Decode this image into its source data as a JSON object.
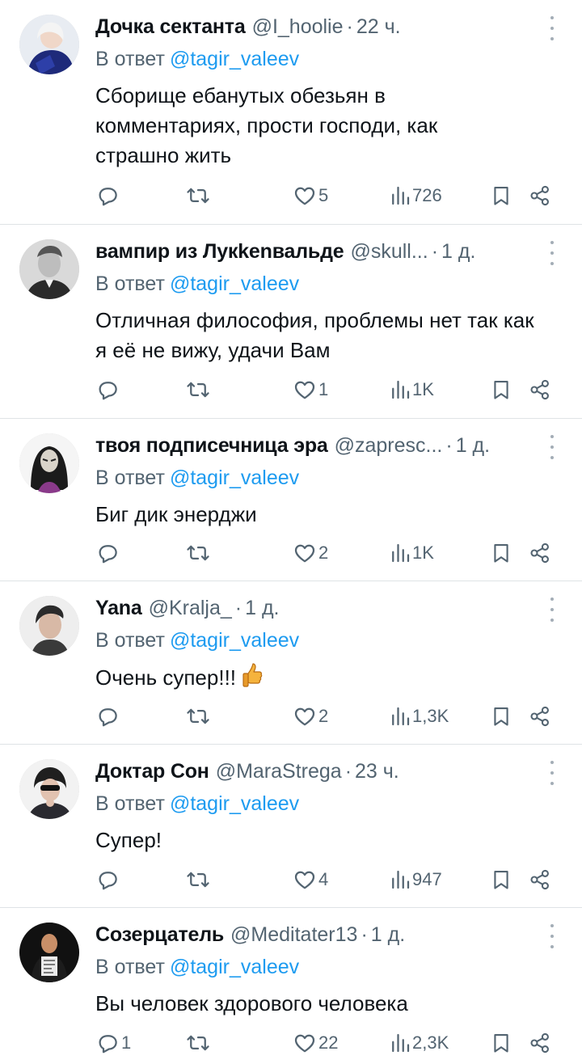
{
  "tweets": [
    {
      "name": "Дочка сектанта",
      "handle": "@I_hoolie",
      "time": "22 ч.",
      "reply_prefix": "В ответ",
      "reply_to": "@tagir_valeev",
      "text": "Сборище ебанутых обезьян в\nкомментариях, прости господи, как\nстрашно жить",
      "replies": "",
      "retweets": "",
      "likes": "5",
      "views": "726"
    },
    {
      "name": "вампир из Лукkenвальде",
      "handle": "@skull...",
      "time": "1 д.",
      "reply_prefix": "В ответ",
      "reply_to": "@tagir_valeev",
      "text": "Отличная философия, проблемы нет так как\nя её не вижу, удачи Вам",
      "replies": "",
      "retweets": "",
      "likes": "1",
      "views": "1K"
    },
    {
      "name": "твоя подписечница эра",
      "handle": "@zapresc...",
      "time": "1 д.",
      "reply_prefix": "В ответ",
      "reply_to": "@tagir_valeev",
      "text": "Биг дик энерджи",
      "replies": "",
      "retweets": "",
      "likes": "2",
      "views": "1K"
    },
    {
      "name": "Yana",
      "handle": "@Kralja_",
      "time": "1 д.",
      "reply_prefix": "В ответ",
      "reply_to": "@tagir_valeev",
      "text": "Очень супер!!!",
      "emoji": "thumbs-up",
      "replies": "",
      "retweets": "",
      "likes": "2",
      "views": "1,3K"
    },
    {
      "name": "Доктар Сон",
      "handle": "@MaraStrega",
      "time": "23 ч.",
      "reply_prefix": "В ответ",
      "reply_to": "@tagir_valeev",
      "text": "Супер!",
      "replies": "",
      "retweets": "",
      "likes": "4",
      "views": "947"
    },
    {
      "name": "Созерцатель",
      "handle": "@Meditater13",
      "time": "1 д.",
      "reply_prefix": "В ответ",
      "reply_to": "@tagir_valeev",
      "text": "Вы человек здорового человека",
      "replies": "1",
      "retweets": "",
      "likes": "22",
      "views": "2,3K"
    }
  ],
  "icons": {
    "reply": "reply-icon",
    "retweet": "retweet-icon",
    "like": "heart-icon",
    "views": "views-icon",
    "bookmark": "bookmark-icon",
    "share": "share-icon",
    "more": "more-icon"
  },
  "colors": {
    "text": "#0f1419",
    "secondary": "#536471",
    "link": "#1d9bf0",
    "divider": "#dfe3e6"
  }
}
